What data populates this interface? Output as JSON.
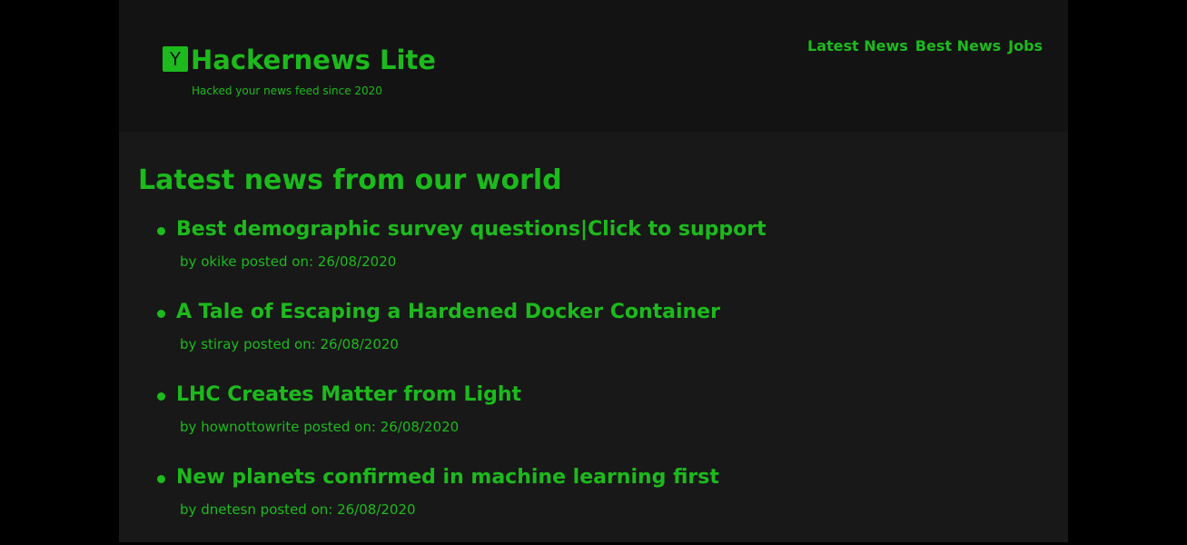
{
  "header": {
    "logo_letter": "Y",
    "title": "Hackernews Lite",
    "tagline": "Hacked your news feed since 2020",
    "nav": [
      {
        "label": "Latest News"
      },
      {
        "label": "Best News"
      },
      {
        "label": "Jobs"
      }
    ]
  },
  "main": {
    "heading": "Latest news from our world",
    "items": [
      {
        "title": "Best demographic survey questions|Click to support",
        "by_prefix": "by",
        "author": "okike",
        "posted_prefix": "posted on:",
        "date": "26/08/2020"
      },
      {
        "title": "A Tale of Escaping a Hardened Docker Container",
        "by_prefix": "by",
        "author": "stiray",
        "posted_prefix": "posted on:",
        "date": "26/08/2020"
      },
      {
        "title": "LHC Creates Matter from Light",
        "by_prefix": "by",
        "author": "hownottowrite",
        "posted_prefix": "posted on:",
        "date": "26/08/2020"
      },
      {
        "title": "New planets confirmed in machine learning first",
        "by_prefix": "by",
        "author": "dnetesn",
        "posted_prefix": "posted on:",
        "date": "26/08/2020"
      }
    ]
  },
  "colors": {
    "accent": "#1cba1c",
    "header_bg": "#131313",
    "page_bg": "#181818",
    "outer_bg": "#000000"
  }
}
